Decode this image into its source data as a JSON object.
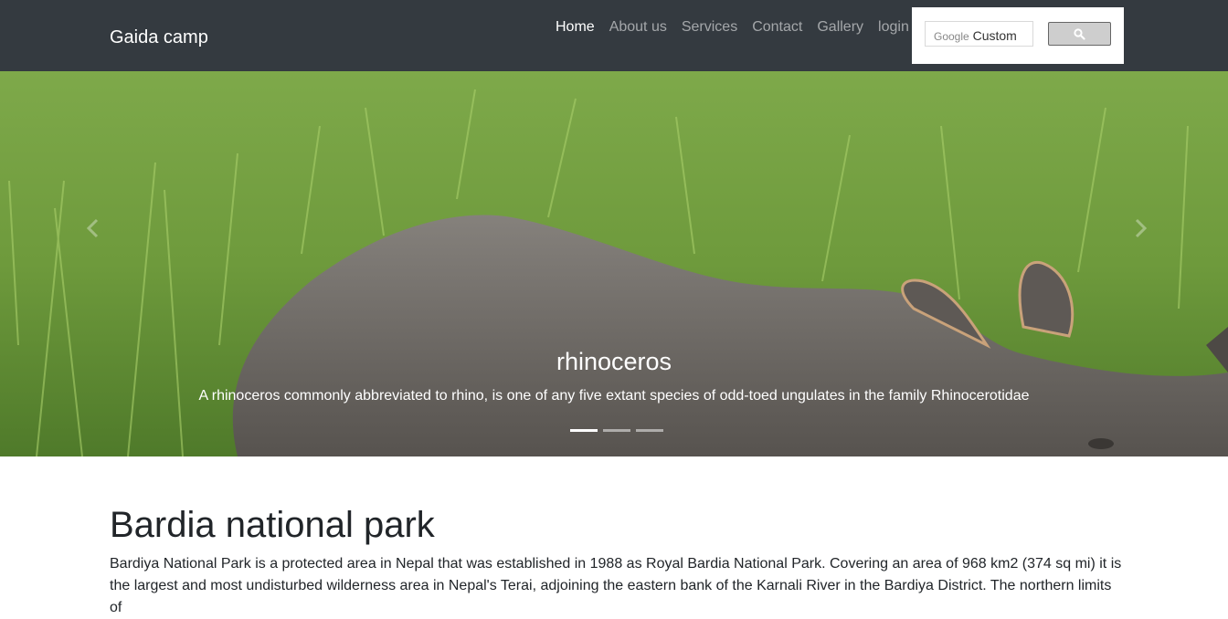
{
  "brand": "Gaida camp",
  "nav": {
    "items": [
      {
        "label": "Home",
        "active": true
      },
      {
        "label": "About us",
        "active": false
      },
      {
        "label": "Services",
        "active": false
      },
      {
        "label": "Contact",
        "active": false
      },
      {
        "label": "Gallery",
        "active": false
      },
      {
        "label": "login",
        "active": false
      }
    ]
  },
  "search": {
    "brand_text": "Google",
    "placeholder_text": "Custom",
    "button_icon": "search-icon"
  },
  "carousel": {
    "slide_title": "rhinoceros",
    "slide_text": "A rhinoceros commonly abbreviated to rhino, is one of any five extant species of odd-toed ungulates in the family Rhinocerotidae",
    "indicator_count": 3,
    "active_indicator": 0,
    "prev_icon": "chevron-left-icon",
    "next_icon": "chevron-right-icon"
  },
  "content": {
    "title": "Bardia national park",
    "paragraph": "Bardiya National Park is a protected area in Nepal that was established in 1988 as Royal Bardia National Park. Covering an area of 968 km2 (374 sq mi) it is the largest and most undisturbed wilderness area in Nepal's Terai, adjoining the eastern bank of the Karnali River in the Bardiya District. The northern limits of"
  },
  "colors": {
    "navbar_bg": "#343a40",
    "grass": "#6f9a3e",
    "rhino": "#6e6a66"
  }
}
